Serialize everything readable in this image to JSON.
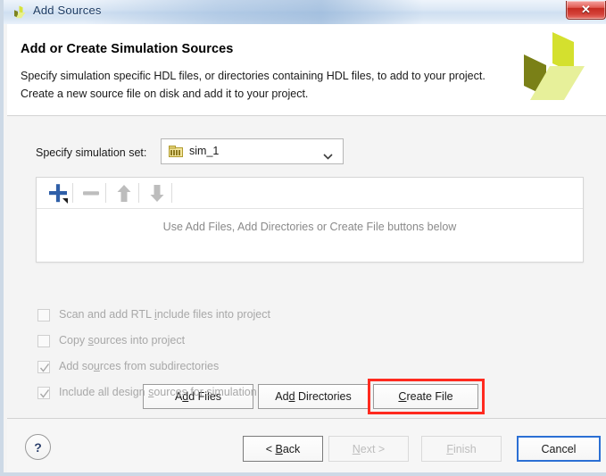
{
  "window": {
    "title": "Add Sources",
    "app_icon": "xilinx-logo-icon",
    "close_label": "✕"
  },
  "header": {
    "title": "Add or Create Simulation Sources",
    "line1": "Specify simulation specific HDL files, or directories containing HDL files, to add to your project.",
    "line2": "Create a new source file on disk and add it to your project.",
    "logo_icon": "xilinx-pinwheel-logo"
  },
  "simulation_set": {
    "label": "Specify simulation set:",
    "value": "sim_1",
    "icon": "simulation-set-icon",
    "chevron_icon": "chevron-down-icon"
  },
  "file_list": {
    "empty_hint": "Use Add Files, Add Directories or Create File buttons below",
    "toolbar": [
      {
        "name": "add-button",
        "icon": "plus-icon",
        "enabled": true
      },
      {
        "name": "remove-button",
        "icon": "minus-icon",
        "enabled": false
      },
      {
        "name": "move-up-button",
        "icon": "arrow-up-icon",
        "enabled": false
      },
      {
        "name": "move-down-button",
        "icon": "arrow-down-icon",
        "enabled": false
      }
    ]
  },
  "action_buttons": {
    "add_files": {
      "pre": "A",
      "mnemonic": "d",
      "post": "d Files",
      "full": "Add Files"
    },
    "add_directories": {
      "pre": "Ad",
      "mnemonic": "d",
      "post": " Directories",
      "full": "Add Directories"
    },
    "create_file": {
      "pre": "",
      "mnemonic": "C",
      "post": "reate File",
      "full": "Create File"
    }
  },
  "highlight": {
    "target": "create-file-button",
    "color": "#ff2a1f"
  },
  "options": [
    {
      "pre": "Scan and add RTL ",
      "mnemonic": "i",
      "post": "nclude files into project",
      "full": "Scan and add RTL include files into project",
      "checked": false,
      "enabled": false
    },
    {
      "pre": "Copy ",
      "mnemonic": "s",
      "post": "ources into project",
      "full": "Copy sources into project",
      "checked": false,
      "enabled": false
    },
    {
      "pre": "Add so",
      "mnemonic": "u",
      "post": "rces from subdirectories",
      "full": "Add sources from subdirectories",
      "checked": true,
      "enabled": false
    },
    {
      "pre": "Include all design ",
      "mnemonic": "s",
      "post": "ources for simulation",
      "full": "Include all design sources for simulation",
      "checked": true,
      "enabled": false
    }
  ],
  "footer": {
    "help_label": "?",
    "buttons": [
      {
        "pre": "< ",
        "mnemonic": "B",
        "post": "ack",
        "full": "< Back",
        "state": "enabled"
      },
      {
        "pre": "",
        "mnemonic": "N",
        "post": "ext >",
        "full": "Next >",
        "state": "disabled"
      },
      {
        "pre": "",
        "mnemonic": "F",
        "post": "inish",
        "full": "Finish",
        "state": "disabled"
      },
      {
        "pre": "",
        "mnemonic": "",
        "post": "Cancel",
        "full": "Cancel",
        "state": "focused"
      }
    ]
  }
}
